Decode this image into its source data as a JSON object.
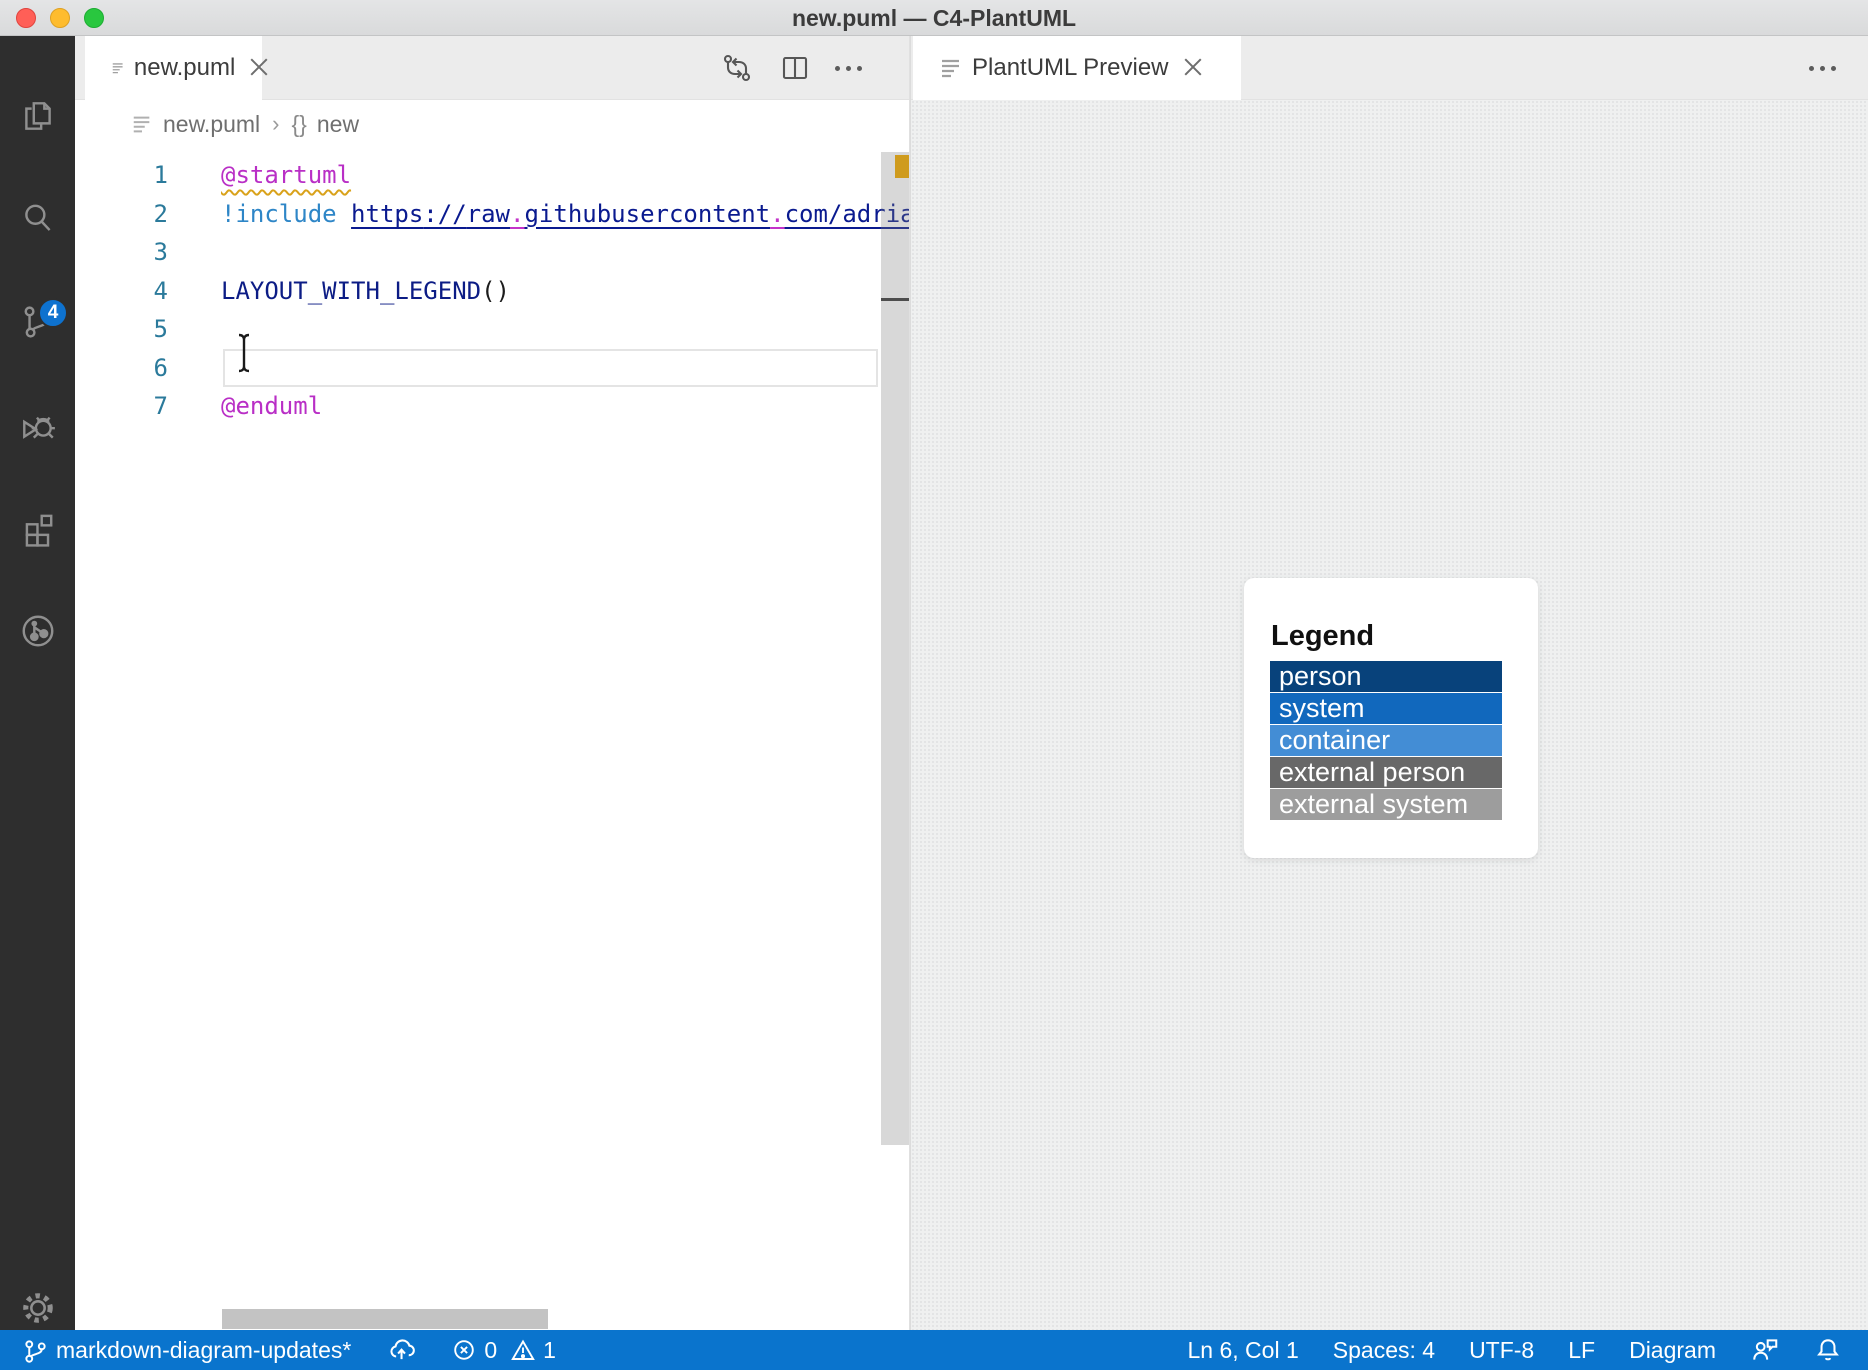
{
  "titlebar": {
    "title": "new.puml — C4-PlantUML"
  },
  "activity_bar": {
    "badge": "4"
  },
  "editor": {
    "tab": {
      "label": "new.puml"
    },
    "breadcrumb": {
      "file": "new.puml",
      "separator": "›",
      "symbol_kind": "{}",
      "symbol": "new"
    },
    "nums": [
      "1",
      "2",
      "3",
      "4",
      "5",
      "6",
      "7"
    ],
    "lines": {
      "l1": {
        "keyword": "@startuml"
      },
      "l2": {
        "directive": "!include",
        "space": " ",
        "u1": "https",
        "u2": "://",
        "u3": "raw",
        "d1": ".",
        "u4": "githubusercontent",
        "d2": ".",
        "u5": "com/adria"
      },
      "l4": {
        "func": "LAYOUT_WITH_LEGEND",
        "paren": "()"
      },
      "l7": {
        "keyword": "@enduml"
      }
    }
  },
  "preview": {
    "tab": {
      "label": "PlantUML Preview"
    },
    "legend": {
      "title": "Legend",
      "rows": [
        {
          "label": "person",
          "color": "#08427B"
        },
        {
          "label": "system",
          "color": "#1168BD"
        },
        {
          "label": "container",
          "color": "#438DD5"
        },
        {
          "label": "external person",
          "color": "#686868"
        },
        {
          "label": "external system",
          "color": "#9D9D9D"
        }
      ]
    }
  },
  "status_bar": {
    "branch": "markdown-diagram-updates*",
    "errors": "0",
    "warnings": "1",
    "line_col": "Ln 6, Col 1",
    "spaces": "Spaces: 4",
    "encoding": "UTF-8",
    "eol": "LF",
    "mode": "Diagram"
  },
  "colors": {
    "statusbar": "#0a74cd",
    "badge": "#0e72cf",
    "warning_marker": "#cf9b1d"
  }
}
